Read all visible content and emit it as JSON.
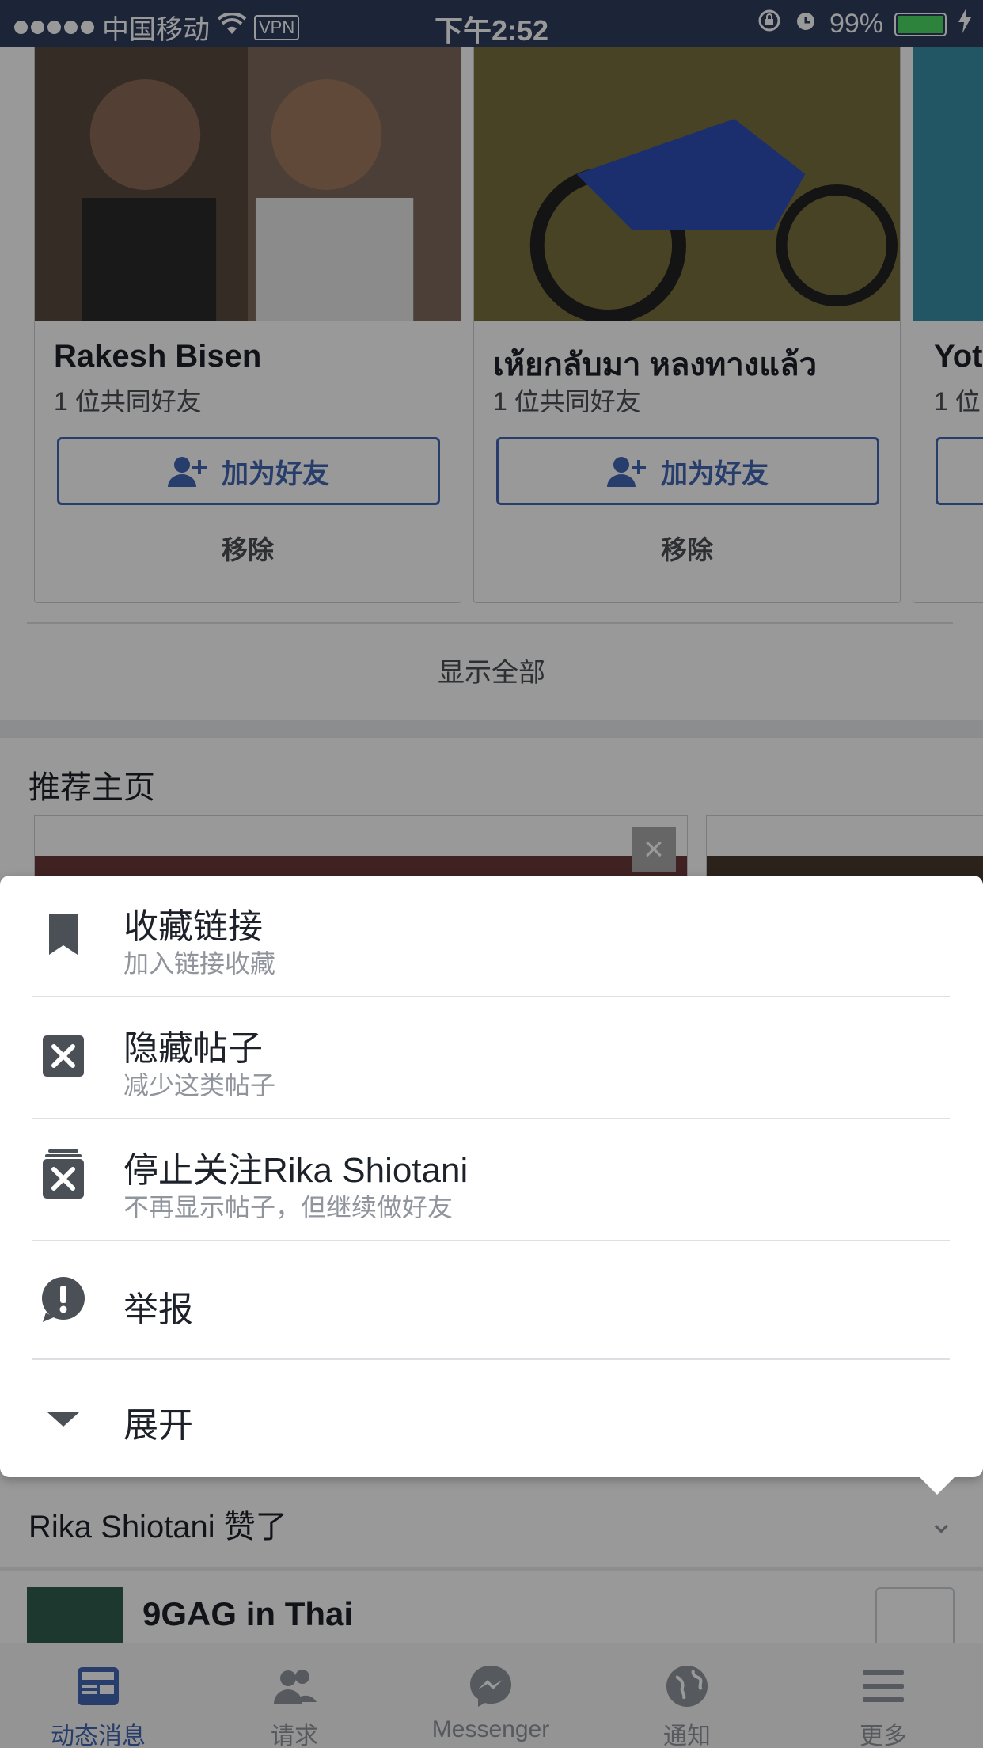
{
  "status_bar": {
    "carrier": "中国移动",
    "vpn": "VPN",
    "time": "下午2:52",
    "battery": "99%"
  },
  "people_you_may_know": {
    "cards": [
      {
        "name": "Rakesh Bisen",
        "mutual": "1 位共同好友",
        "add_label": "加为好友",
        "remove_label": "移除"
      },
      {
        "name": "เห้ยกลับมา หลงทางแล้ว",
        "mutual": "1 位共同好友",
        "add_label": "加为好友",
        "remove_label": "移除"
      },
      {
        "name": "Yot",
        "mutual": "1 位"
      }
    ],
    "show_all": "显示全部"
  },
  "suggested_pages": {
    "title": "推荐主页"
  },
  "action_sheet": {
    "items": [
      {
        "title": "收藏链接",
        "subtitle": "加入链接收藏",
        "icon": "bookmark-icon"
      },
      {
        "title": "隐藏帖子",
        "subtitle": "减少这类帖子",
        "icon": "hide-icon"
      },
      {
        "title": "停止关注Rika Shiotani",
        "subtitle": "不再显示帖子，但继续做好友",
        "icon": "unfollow-icon"
      },
      {
        "title": "举报",
        "icon": "report-icon"
      },
      {
        "title": "展开",
        "icon": "chevron-down-icon"
      }
    ]
  },
  "feed_story": {
    "liked_text": "Rika Shiotani 赞了",
    "page_name": "9GAG in Thai"
  },
  "tab_bar": {
    "tabs": [
      {
        "label": "动态消息",
        "icon": "news-feed-icon",
        "active": true
      },
      {
        "label": "请求",
        "icon": "friend-requests-icon"
      },
      {
        "label": "Messenger",
        "icon": "messenger-icon"
      },
      {
        "label": "通知",
        "icon": "notifications-globe-icon"
      },
      {
        "label": "更多",
        "icon": "menu-icon"
      }
    ]
  },
  "colors": {
    "status_bar": "#2f3d5e",
    "brand_blue": "#4267b2",
    "battery_green": "#4cd964"
  }
}
